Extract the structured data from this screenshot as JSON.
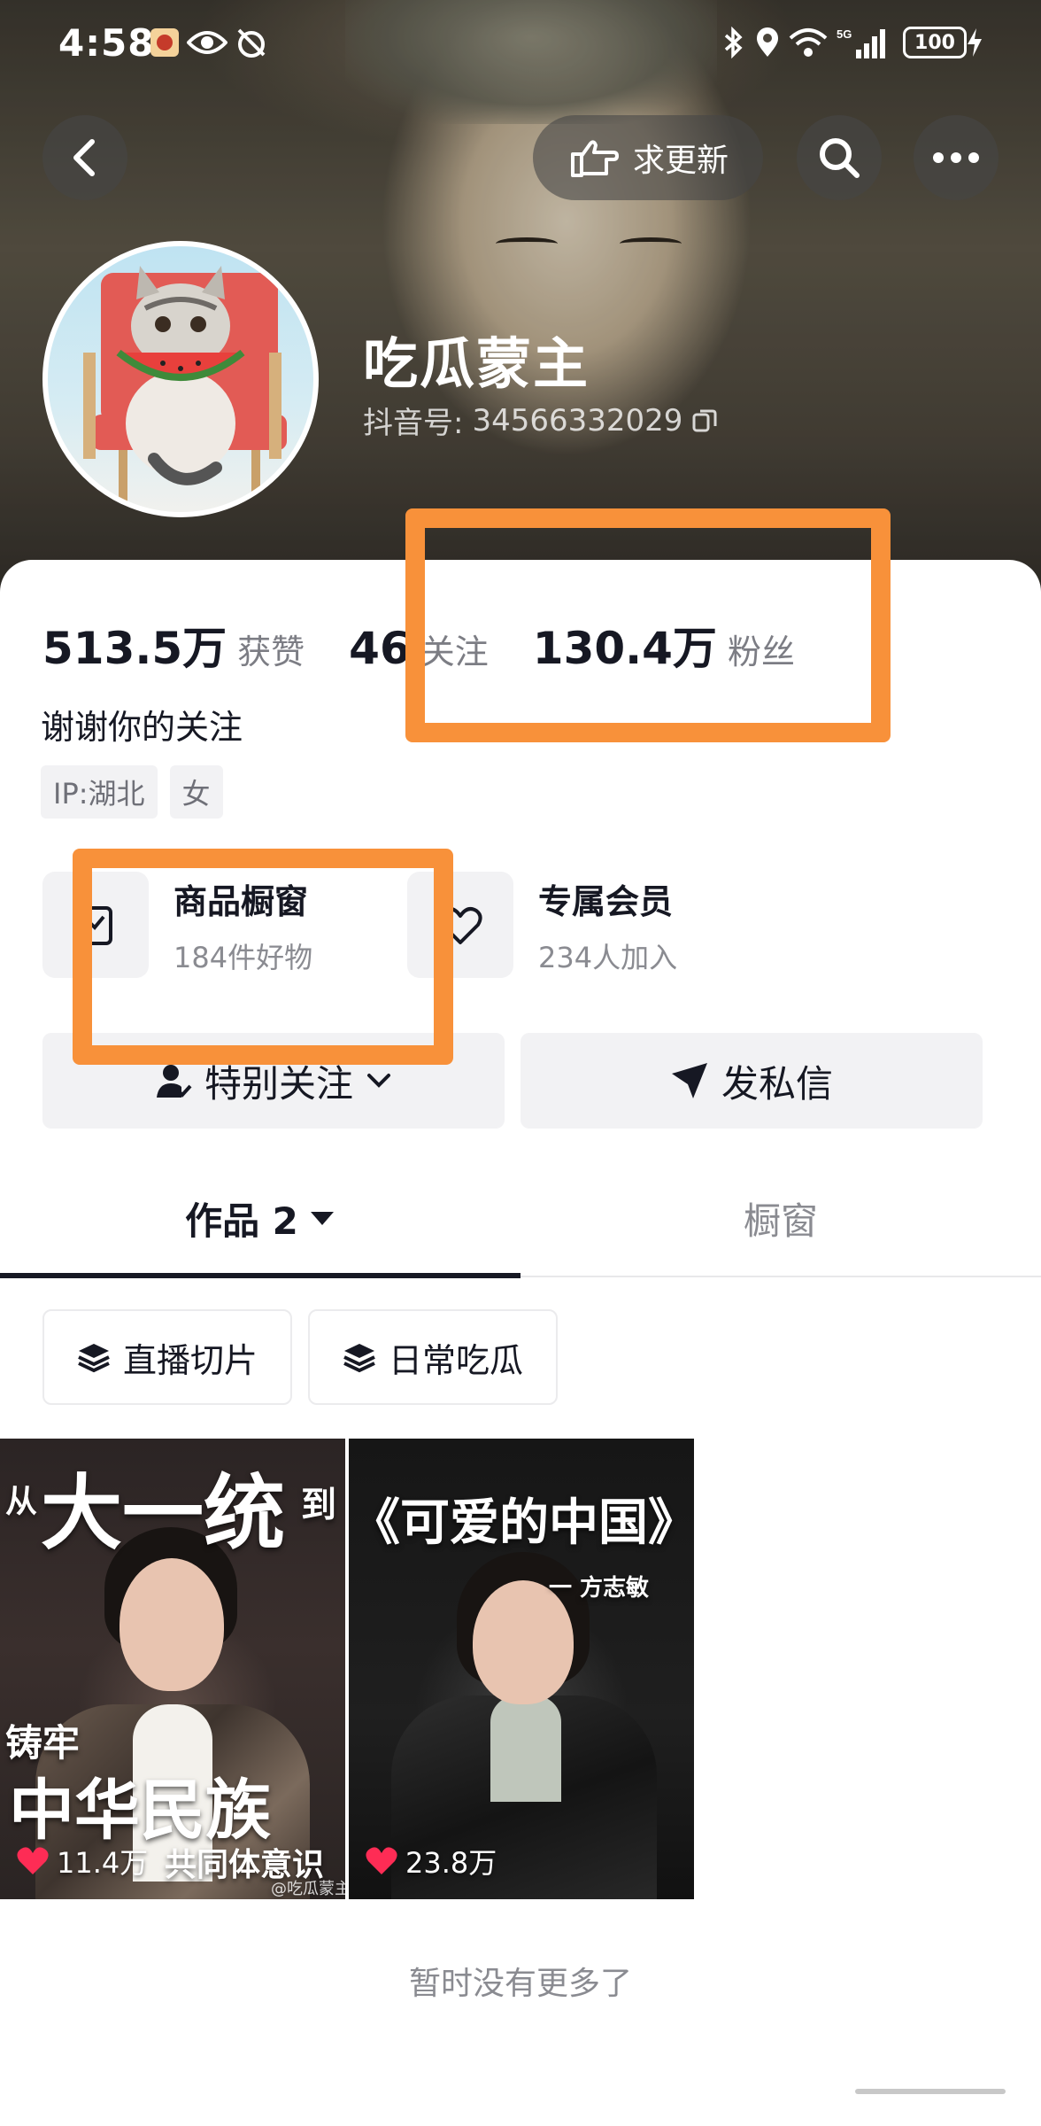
{
  "status_bar": {
    "time": "4:58",
    "battery": "100",
    "network": "5G"
  },
  "header": {
    "update_request_label": "求更新",
    "icons": [
      "back-arrow-icon",
      "hand-pointing-icon",
      "search-icon",
      "more-dots-icon"
    ]
  },
  "profile": {
    "name": "吃瓜蒙主",
    "id_label": "抖音号:",
    "id_value": "34566332029"
  },
  "stats": {
    "likes_value": "513.5万",
    "likes_label": "获赞",
    "following_value": "46",
    "following_label": "关注",
    "followers_value": "130.4万",
    "followers_label": "粉丝"
  },
  "bio": "谢谢你的关注",
  "tags": [
    "IP:湖北",
    "女"
  ],
  "features": {
    "shop_title": "商品橱窗",
    "shop_sub": "184件好物",
    "member_title": "专属会员",
    "member_sub": "234人加入"
  },
  "actions": {
    "follow_label": "特别关注",
    "message_label": "发私信"
  },
  "tabs": {
    "works_label": "作品 2",
    "showcase_label": "橱窗"
  },
  "chips": {
    "chip1": "直播切片",
    "chip2": "日常吃瓜"
  },
  "videos": {
    "v1": {
      "small_left": "从",
      "big_title": "大一统",
      "small_right": "到",
      "side_text": "铸牢",
      "bottom_title": "中华民族",
      "bottom_sub": "共同体意识",
      "watermark": "@吃瓜蒙主",
      "likes": "11.4万"
    },
    "v2": {
      "title": "《可爱的中国》",
      "author": "一 方志敏",
      "likes": "23.8万"
    }
  },
  "end_note": "暂时没有更多了",
  "colors": {
    "annotation": "#f8913a",
    "like_heart": "#fe2c55",
    "text_primary": "#161823",
    "text_secondary": "#8a8b91"
  }
}
